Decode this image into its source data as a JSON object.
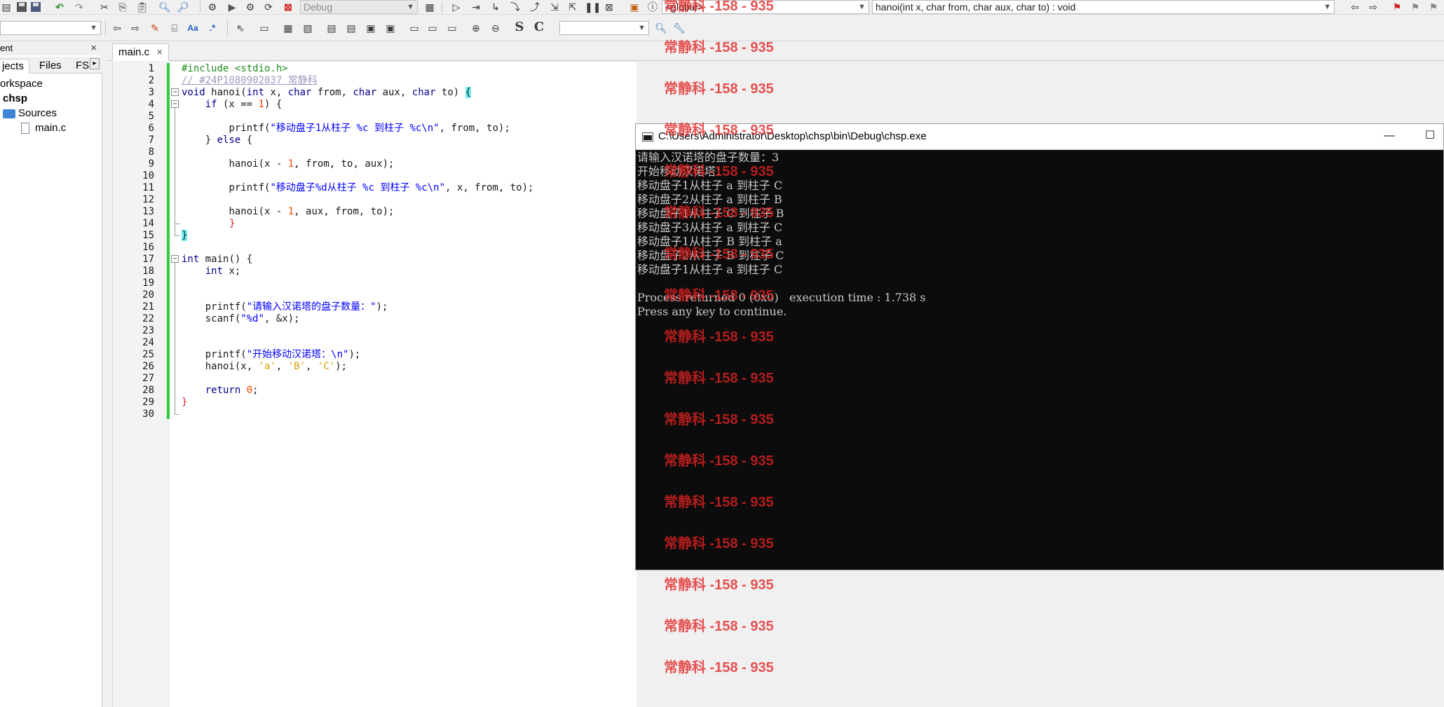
{
  "toolbar": {
    "build_target": "Debug",
    "scope": "<global>",
    "function": "hanoi(int x, char from, char aux, char to) : void",
    "search_box": ""
  },
  "management": {
    "title": "ent",
    "close": "×",
    "tabs": [
      "jects",
      "Files",
      "FS"
    ],
    "tab_arrow": "▸",
    "tree": {
      "workspace": "orkspace",
      "project": "chsp",
      "sources": "Sources",
      "file": "main.c"
    }
  },
  "editor": {
    "tab_label": "main.c",
    "tab_close": "×",
    "line_numbers": [
      "1",
      "2",
      "3",
      "4",
      "5",
      "6",
      "7",
      "8",
      "9",
      "10",
      "11",
      "12",
      "13",
      "14",
      "15",
      "16",
      "17",
      "18",
      "19",
      "20",
      "21",
      "22",
      "23",
      "24",
      "25",
      "26",
      "27",
      "28",
      "29",
      "30"
    ]
  },
  "code": {
    "l1": "#include <stdio.h>",
    "l2": "// #24P1080902037 常静科",
    "l3_a": "void",
    "l3_b": " hanoi(",
    "l3_c": "int",
    "l3_d": " x, ",
    "l3_e": "char",
    "l3_f": " from, ",
    "l3_g": "char",
    "l3_h": " aux, ",
    "l3_i": "char",
    "l3_j": " to) ",
    "l3_k": "{",
    "l4_a": "if",
    "l4_b": " (x == ",
    "l4_c": "1",
    "l4_d": ") {",
    "l6_a": "printf(",
    "l6_b": "\"移动盘子1从柱子 %c 到柱子 %c\\n\"",
    "l6_c": ", from, to);",
    "l7_a": "} ",
    "l7_b": "else",
    "l7_c": " {",
    "l9_a": "hanoi(x - ",
    "l9_b": "1",
    "l9_c": ", from, to, aux);",
    "l11_a": "printf(",
    "l11_b": "\"移动盘子%d从柱子 %c 到柱子 %c\\n\"",
    "l11_c": ", x, from, to);",
    "l13_a": "hanoi(x - ",
    "l13_b": "1",
    "l13_c": ", aux, from, to);",
    "l14": "}",
    "l15": "}",
    "l17_a": "int",
    "l17_b": " main() {",
    "l18_a": "int",
    "l18_b": " x;",
    "l21_a": "printf(",
    "l21_b": "\"请输入汉诺塔的盘子数量：\"",
    "l21_c": ");",
    "l22_a": "scanf(",
    "l22_b": "\"%d\"",
    "l22_c": ", &x);",
    "l25_a": "printf(",
    "l25_b": "\"开始移动汉诺塔：\\n\"",
    "l25_c": ");",
    "l26_a": "hanoi(x, ",
    "l26_b": "'a'",
    "l26_c": ", ",
    "l26_d": "'B'",
    "l26_e": ", ",
    "l26_f": "'C'",
    "l26_g": ");",
    "l28_a": "return",
    "l28_b": " ",
    "l28_c": "0",
    "l28_d": ";",
    "l29": "}"
  },
  "console": {
    "title": "C:\\Users\\Administrator\\Desktop\\chsp\\bin\\Debug\\chsp.exe",
    "minimize": "—",
    "maximize": "☐",
    "lines": [
      "请输入汉诺塔的盘子数量：3",
      "开始移动汉诺塔：",
      "移动盘子1从柱子 a 到柱子 C",
      "移动盘子2从柱子 a 到柱子 B",
      "移动盘子1从柱子 C 到柱子 B",
      "移动盘子3从柱子 a 到柱子 C",
      "移动盘子1从柱子 B 到柱子 a",
      "移动盘子2从柱子 B 到柱子 C",
      "移动盘子1从柱子 a 到柱子 C",
      "",
      "Process returned 0 (0x0)   execution time : 1.738 s",
      "Press any key to continue."
    ]
  },
  "watermark": {
    "text": "常静科 -158 - 935"
  }
}
